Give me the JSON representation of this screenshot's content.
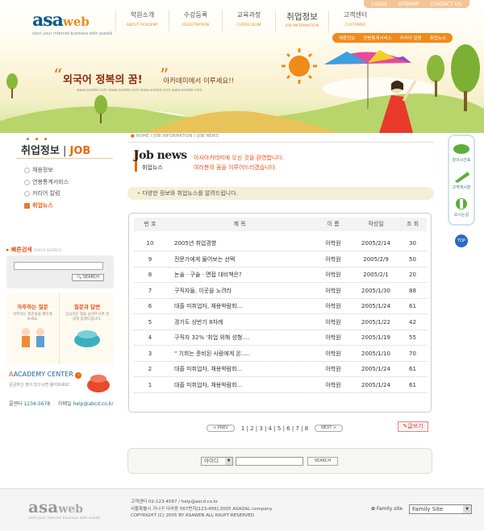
{
  "top_links": [
    "LOGIN",
    "SITEMAP",
    "CONTACT US"
  ],
  "logo": {
    "a": "asa",
    "web": "web",
    "tagline": "start your internet business with asadal"
  },
  "nav": [
    {
      "ko": "학원소개",
      "en": "ABOUT ACADEMY"
    },
    {
      "ko": "수강등록",
      "en": "REGISTRATION"
    },
    {
      "ko": "교육과정",
      "en": "CURRICULUM"
    },
    {
      "ko": "취업정보",
      "en": "JOB INFORMATION"
    },
    {
      "ko": "고객센터",
      "en": "CUSTOMER"
    }
  ],
  "subnav": [
    "채용정보",
    "연봉통계서비스",
    "커리어 칼럼",
    "취업뉴스"
  ],
  "slogan": {
    "main": "외국어 정복의 꿈!",
    "sub": "아카데미에서 이루세요!!",
    "desc": "www.asadal.com www.asadal.com www.asadal.com www.asadal.com"
  },
  "sidebar": {
    "title_ko": "취업정보",
    "title_en": "JOB",
    "items": [
      "채용정보",
      "연봉통계서비스",
      "커리어 칼럼",
      "취업뉴스"
    ],
    "quick_search": "빠른검색",
    "quick_search_en": "QUICK SEARCH",
    "search_btn": "SEARCH",
    "faq_title": "자주하는 질문",
    "faq_desc": "자주하는 질문들을 확인해 보세요.",
    "qa_title": "질문과 답변",
    "qa_desc": "궁금하신 점을 남겨주시면 성의껏 답해드립니다.",
    "academy": "ACADEMY CENTER",
    "academy_desc": "궁금하신 점이 있으시면 물어보세요!",
    "call_label": "콜센터",
    "call": "1234-5678",
    "email_label": "이메일",
    "email": "help@abcd.co.kr"
  },
  "breadcrumb": "HOME / JOB INFORMATION / JOB NEWS",
  "page_title": "Job news",
  "page_title_ko": "취업뉴스",
  "intro": [
    "아사아카데미에 오신 것을 환영합니다.",
    "여러분의 꿈을 이루어드리겠습니다."
  ],
  "info_bar": "다양한 정보와 취업뉴스를 알려드립니다.",
  "table_headers": [
    "번 호",
    "제 목",
    "이 름",
    "작성일",
    "조 회"
  ],
  "rows": [
    [
      "10",
      "2005년 취업경향",
      "아학원",
      "2005/2/14",
      "30"
    ],
    [
      "9",
      "전문가에게 물어보는 선택",
      "아학원",
      "2005/2/9",
      "50"
    ],
    [
      "8",
      "논술 · 구술 · 면접 대비책은?",
      "아학원",
      "2005/2/1",
      "20"
    ],
    [
      "7",
      "구직자들, 이곳을 노려라",
      "아학원",
      "2005/1/30",
      "88"
    ],
    [
      "6",
      "대졸 미취업자, 채용박람회...",
      "아학원",
      "2005/1/24",
      "61"
    ],
    [
      "5",
      "경기도 상반기 8차례",
      "아학원",
      "2005/1/22",
      "42"
    ],
    [
      "4",
      "구직자 32% '취업 위해 성형....",
      "아학원",
      "2005/1/19",
      "55"
    ],
    [
      "3",
      "\" 기회는 준비된 사람에게 온.....",
      "아학원",
      "2005/1/10",
      "70"
    ],
    [
      "2",
      "대졸 미취업자, 채용박람회...",
      "아학원",
      "2005/1/24",
      "61"
    ],
    [
      "1",
      "대졸 미취업자, 채용박람회...",
      "아학원",
      "2005/1/24",
      "61"
    ]
  ],
  "pager": {
    "prev": "< PREV",
    "next": "NEXT >",
    "pages": "1 | 2 | 3 | 4 | 5 | 6 | 7 | 8"
  },
  "write_btn": "글쓰기",
  "search": {
    "select": "아이디",
    "btn": "SEARCH"
  },
  "right_sidebar": [
    "강의시간표",
    "고객게시판",
    "오시는길"
  ],
  "top_btn": "TOP",
  "footer": {
    "line1": "고객센터 02-123-4567 / help@ascd.co.kr",
    "line2": "서울특별시 가나구 다라동 567번지[123-456] 2005 ASADAL company",
    "line3": "COPYRIGHT (C) 2005 BY ASAWEB ALL RIGHT RESERVED",
    "family_label": "Family site",
    "family_select": "Family Site"
  }
}
